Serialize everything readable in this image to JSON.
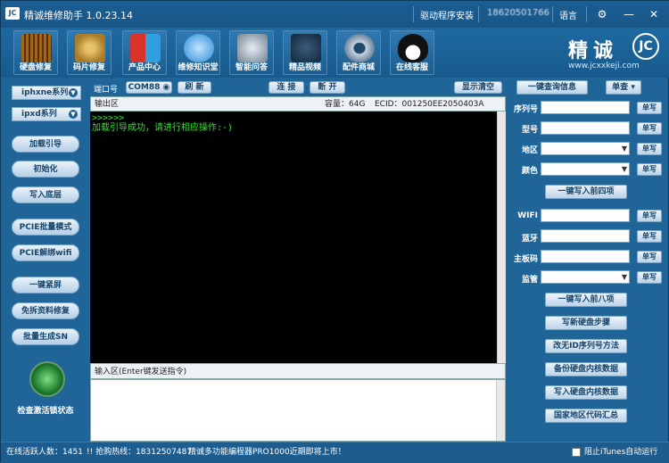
{
  "titlebar": {
    "title": "精诚维修助手 1.0.23.14",
    "driver": "驱动程序安装",
    "phone": "18620501766",
    "language": "语言",
    "buttons": {
      "settings": "⚙",
      "minimize": "—",
      "close": "✕"
    }
  },
  "toolbar": [
    {
      "label": "硬盘修复",
      "icon": "disk-chip-icon",
      "color": "#b88a3a"
    },
    {
      "label": "码片修复",
      "icon": "chip-icon",
      "color": "#c49a43"
    },
    {
      "label": "产品中心",
      "icon": "product-blocks-icon",
      "color": "#3aa3e0"
    },
    {
      "label": "维修知识堂",
      "icon": "chat-bubble-icon",
      "color": "#2a8ad6"
    },
    {
      "label": "智能问答",
      "icon": "robot-icon",
      "color": "#8a9aa8"
    },
    {
      "label": "精品视频",
      "icon": "video-camera-icon",
      "color": "#2a4d6e"
    },
    {
      "label": "配件商城",
      "icon": "gear-icon",
      "color": "#4a6a88"
    },
    {
      "label": "在线客服",
      "icon": "qq-penguin-icon",
      "color": "#2a7bc0"
    }
  ],
  "brand": {
    "name": "精诚",
    "logo": "JC",
    "url": "www.jcxxkeji.com"
  },
  "left": {
    "series1": "iphxne系列",
    "series2": "ipxd系列",
    "buttons": [
      "加载引导",
      "初始化",
      "写入底层",
      "PCIE批量模式",
      "PCIE解绑wifi",
      "一键紧屏",
      "免拆资料修复",
      "批量生成SN"
    ],
    "radar_label": "检查激活锁状态"
  },
  "mid": {
    "port_label": "端口号",
    "port_value": "COM88",
    "refresh": "刷 新",
    "connect": "连 接",
    "disconnect": "断 开",
    "clear": "显示清空",
    "output_title": "输出区",
    "capacity": "容量：64G",
    "ecid": "ECID：001250EE2050403A",
    "output_lines": [
      ">>>>>>",
      "加载引导成功，请进行相应操作:-)"
    ],
    "input_title": "输入区(Enter键发送指令)"
  },
  "right": {
    "query_btn": "一键查询信息",
    "single": "单查",
    "fields": [
      {
        "label": "序列号",
        "type": "text"
      },
      {
        "label": "型号",
        "type": "text"
      },
      {
        "label": "地区",
        "type": "select"
      },
      {
        "label": "颜色",
        "type": "select"
      }
    ],
    "write_btn": "单写",
    "write_four": "一键写入前四项",
    "fields2": [
      {
        "label": "WIFI",
        "type": "text"
      },
      {
        "label": "蓝牙",
        "type": "text"
      },
      {
        "label": "主板码",
        "type": "text"
      },
      {
        "label": "监管",
        "type": "select"
      }
    ],
    "write_eight": "一键写入前八项",
    "actions": [
      "写新硬盘步骤",
      "改无ID序列号方法",
      "备份硬盘内核数据",
      "写入硬盘内核数据",
      "国家地区代码汇总"
    ]
  },
  "status": {
    "online": "在线活跃人数：1451",
    "hotline": "!! 抢购热线：18312507487",
    "notice": "精诚多功能编程器PRO1000近期即将上市！",
    "itunes": "阻止iTunes自动运行"
  }
}
